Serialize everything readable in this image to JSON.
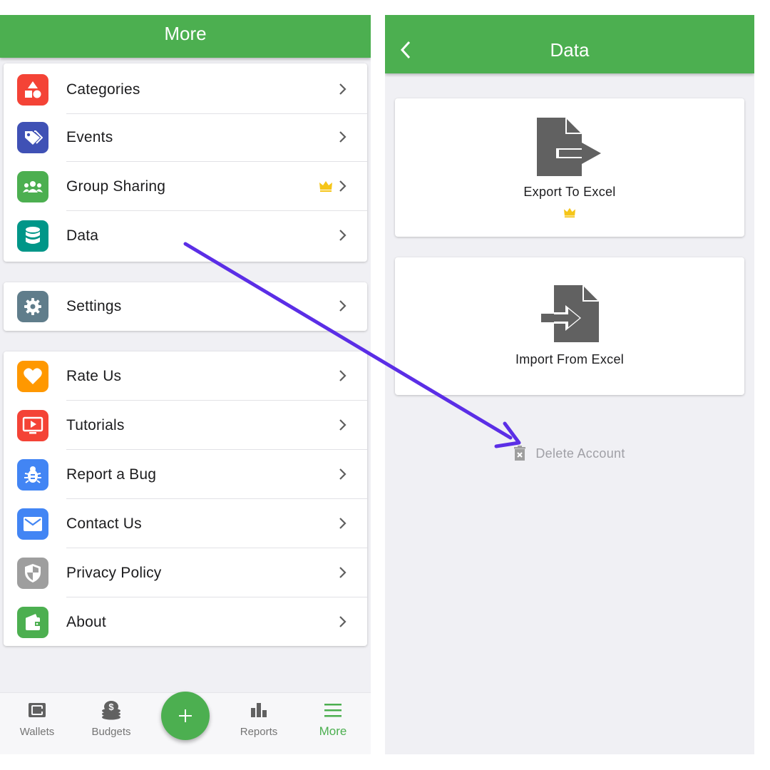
{
  "left_screen": {
    "header": {
      "title": "More"
    },
    "groups": [
      {
        "items": [
          {
            "label": "Categories",
            "icon": "shapes-icon",
            "color": "#f44336"
          },
          {
            "label": "Events",
            "icon": "tags-icon",
            "color": "#3f51b5"
          },
          {
            "label": "Group Sharing",
            "icon": "group-icon",
            "color": "#4caf50",
            "premium": true
          },
          {
            "label": "Data",
            "icon": "database-icon",
            "color": "#009688"
          }
        ]
      },
      {
        "items": [
          {
            "label": "Settings",
            "icon": "gear-icon",
            "color": "#607d8b"
          }
        ]
      },
      {
        "items": [
          {
            "label": "Rate Us",
            "icon": "heart-icon",
            "color": "#ff9800"
          },
          {
            "label": "Tutorials",
            "icon": "video-icon",
            "color": "#f44336"
          },
          {
            "label": "Report a Bug",
            "icon": "bug-icon",
            "color": "#4285f4"
          },
          {
            "label": "Contact Us",
            "icon": "mail-icon",
            "color": "#4285f4"
          },
          {
            "label": "Privacy Policy",
            "icon": "shield-icon",
            "color": "#9e9e9e"
          },
          {
            "label": "About",
            "icon": "wallet-icon",
            "color": "#4caf50"
          }
        ]
      }
    ],
    "tabbar": {
      "tabs": [
        {
          "label": "Wallets",
          "icon": "wallet-icon"
        },
        {
          "label": "Budgets",
          "icon": "coins-icon"
        },
        {
          "label": "Reports",
          "icon": "bar-chart-icon"
        },
        {
          "label": "More",
          "icon": "menu-icon",
          "active": true
        }
      ],
      "fab_symbol": "+"
    }
  },
  "right_screen": {
    "header": {
      "title": "Data",
      "back_icon": "chevron-left-icon"
    },
    "actions": [
      {
        "label": "Export To Excel",
        "icon": "file-export-icon",
        "premium": true
      },
      {
        "label": "Import From Excel",
        "icon": "file-import-icon"
      }
    ],
    "delete": {
      "label": "Delete Account",
      "icon": "trash-icon"
    }
  },
  "colors": {
    "brand_green": "#4caf50",
    "crown_gold": "#f5c518",
    "annotation_arrow": "#5b2ee6",
    "icon_gray": "#616161"
  }
}
